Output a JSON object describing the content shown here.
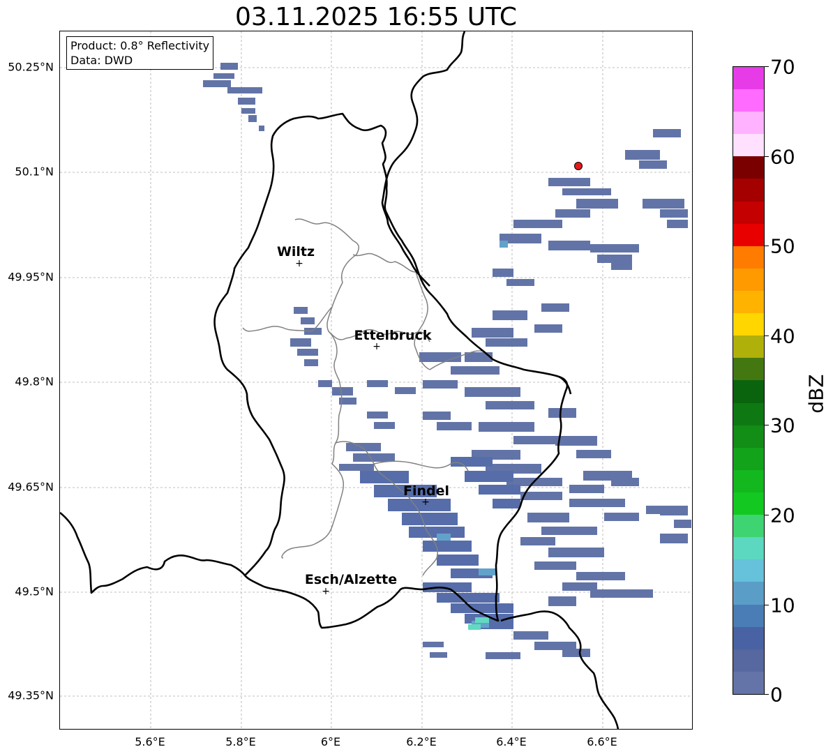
{
  "title": "03.11.2025 16:55 UTC",
  "info": {
    "product": "Product: 0.8° Reflectivity",
    "data": "Data: DWD"
  },
  "lat_labels": [
    "50.25°N",
    "50.1°N",
    "49.95°N",
    "49.8°N",
    "49.65°N",
    "49.5°N",
    "49.35°N"
  ],
  "lon_labels": [
    "5.6°E",
    "5.8°E",
    "6°E",
    "6.2°E",
    "6.4°E",
    "6.6°E"
  ],
  "cities": [
    {
      "name": "Wiltz"
    },
    {
      "name": "Ettelbruck"
    },
    {
      "name": "Findel"
    },
    {
      "name": "Esch/Alzette"
    }
  ],
  "colorbar": {
    "label": "dBZ",
    "ticks": [
      "0",
      "10",
      "20",
      "30",
      "40",
      "50",
      "60",
      "70"
    ],
    "colors": [
      "#6474a8",
      "#56689f",
      "#4962a4",
      "#4a7db5",
      "#5a9ec8",
      "#66c1da",
      "#5bd8bf",
      "#3ed472",
      "#13c820",
      "#12b81d",
      "#13a31b",
      "#128d16",
      "#0e7912",
      "#0a640e",
      "#437811",
      "#b0b00a",
      "#ffd600",
      "#ffb300",
      "#ff9a00",
      "#ff7c00",
      "#e80000",
      "#c40000",
      "#a40000",
      "#7a0000",
      "#ffe1ff",
      "#ffb2ff",
      "#ff6bff",
      "#e83be8"
    ]
  },
  "marker_symbol": "+"
}
